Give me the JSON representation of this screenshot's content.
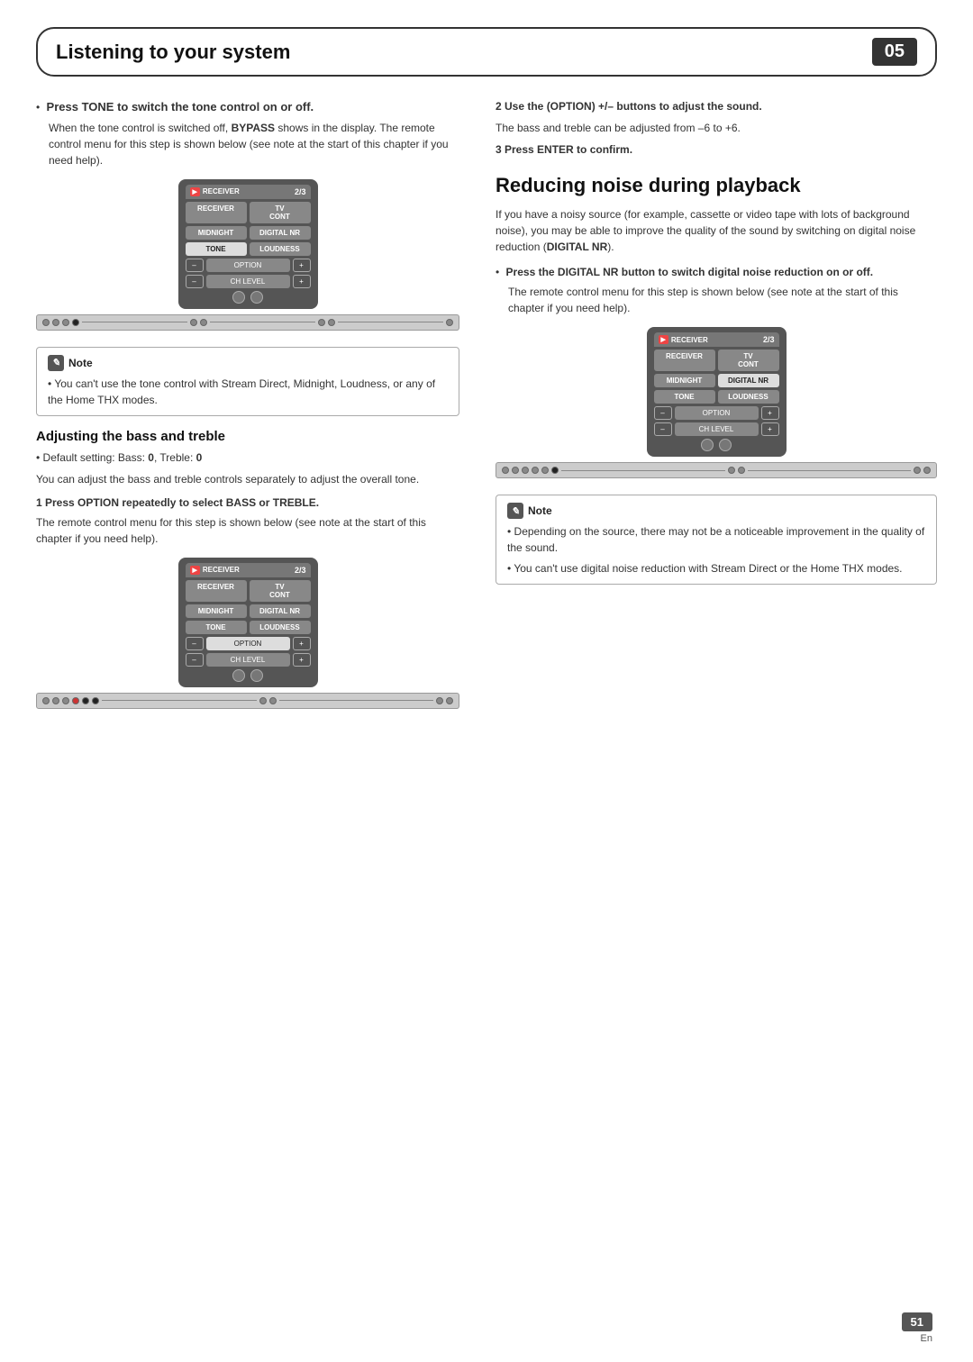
{
  "header": {
    "title": "Listening to your system",
    "chapter": "05"
  },
  "left_column": {
    "bullet1": {
      "bold": "Press TONE to switch the tone control on or off.",
      "body": "When the tone control is switched off, BYPASS shows in the display. The remote control menu for this step is shown below (see note at the start of this chapter if you need help)."
    },
    "remote1": {
      "label": "RECEIVER",
      "page": "2/3",
      "buttons": [
        "RECEIVER",
        "TV CONT",
        "MIDNIGHT",
        "DIGITAL NR",
        "TONE",
        "LOUDNESS"
      ],
      "tone_highlighted": true
    },
    "note": {
      "header": "Note",
      "items": [
        "You can't use the tone control with Stream Direct, Midnight, Loudness, or any of the Home THX modes."
      ]
    },
    "adjusting_section": {
      "heading": "Adjusting the bass and treble",
      "default": "Default setting: Bass: 0, Treble: 0",
      "body1": "You can adjust the bass and treble controls separately to adjust the overall tone.",
      "step1_bold": "1   Press OPTION repeatedly to select BASS or TREBLE.",
      "step1_body": "The remote control menu for this step is shown below (see note at the start of this chapter if you need help).",
      "remote2": {
        "label": "RECEIVER",
        "page": "2/3",
        "option_highlighted": true
      },
      "step2_bold": "2   Use the (OPTION) +/– buttons to adjust the sound.",
      "step2_body": "The bass and treble can be adjusted from –6 to +6.",
      "step3_bold": "3   Press ENTER to confirm."
    }
  },
  "right_column": {
    "big_heading": "Reducing noise during playback",
    "intro": "If you have a noisy source (for example, cassette or video tape with lots of background noise), you may be able to improve the quality of the sound by switching on digital noise reduction (DIGITAL NR).",
    "bullet1": {
      "bold": "Press the DIGITAL NR button to switch digital noise reduction on or off.",
      "body": "The remote control menu for this step is shown below (see note at the start of this chapter if you need help)."
    },
    "remote3": {
      "label": "RECEIVER",
      "page": "2/3",
      "digital_nr_highlighted": true
    },
    "note": {
      "header": "Note",
      "items": [
        "Depending on the source, there may not be a noticeable improvement in the quality of the sound.",
        "You can't use digital noise reduction with Stream Direct or the Home THX modes."
      ]
    }
  },
  "footer": {
    "page_number": "51",
    "lang": "En"
  }
}
